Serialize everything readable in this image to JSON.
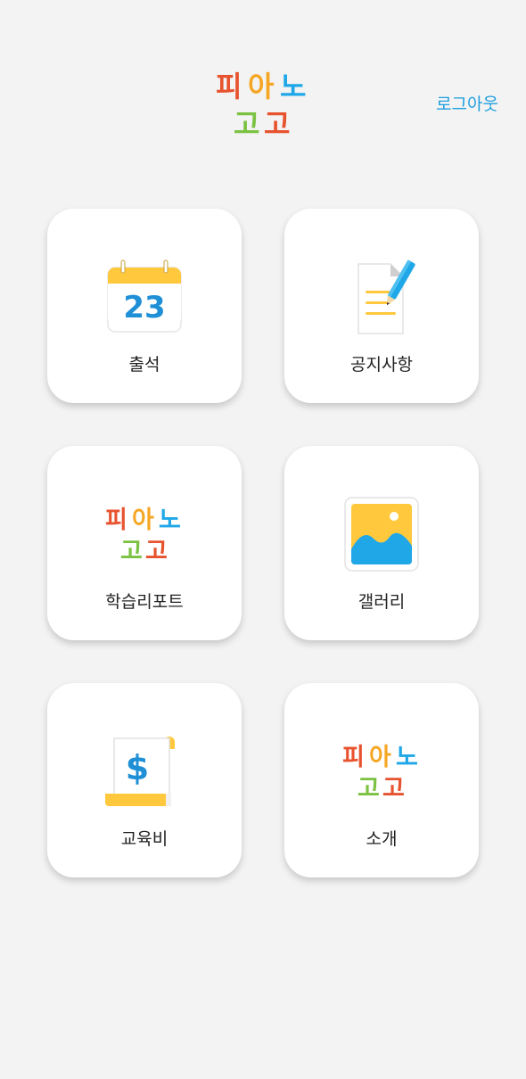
{
  "header": {
    "logo_line1": [
      "피",
      "아",
      "노"
    ],
    "logo_line2": [
      "고",
      "고"
    ],
    "logout_label": "로그아웃"
  },
  "colors": {
    "accent": "#1f9fe0",
    "logo_red": "#e8532f",
    "logo_orange": "#f5a623",
    "logo_blue": "#1fa7e8",
    "logo_green": "#7cc242",
    "calendar_yellow": "#ffc83d",
    "calendar_number": "#1f8fd6",
    "gallery_blue": "#1fa7e8"
  },
  "menu": {
    "items": [
      {
        "label": "출석",
        "icon": "calendar-icon",
        "calendar_day": "23"
      },
      {
        "label": "공지사항",
        "icon": "notice-icon"
      },
      {
        "label": "학습리포트",
        "icon": "logo-icon"
      },
      {
        "label": "갤러리",
        "icon": "gallery-icon"
      },
      {
        "label": "교육비",
        "icon": "tuition-icon",
        "currency_symbol": "$"
      },
      {
        "label": "소개",
        "icon": "logo-icon"
      }
    ]
  }
}
